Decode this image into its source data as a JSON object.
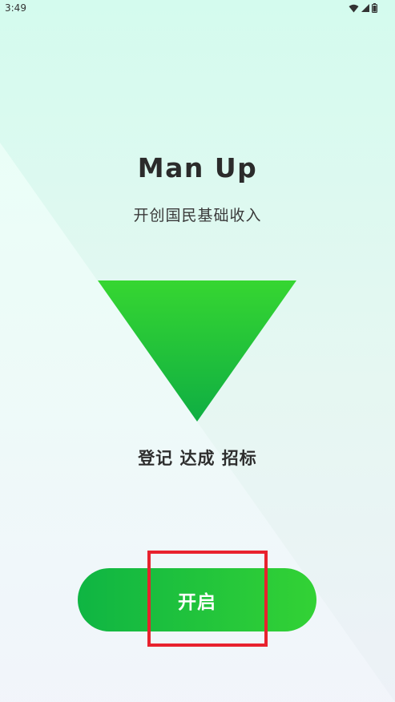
{
  "status_bar": {
    "time": "3:49",
    "icons": [
      "wifi-icon",
      "cell-signal-icon",
      "battery-icon"
    ]
  },
  "app": {
    "title": "Man Up",
    "subtitle": "开创国民基础收入",
    "tagline": "登记 达成 招标"
  },
  "actions": {
    "start_label": "开启"
  },
  "colors": {
    "button_start": "#0fb543",
    "button_end": "#33d235",
    "triangle_top": "#36d631",
    "triangle_bottom": "#0fae43",
    "highlight": "#e8222e"
  }
}
